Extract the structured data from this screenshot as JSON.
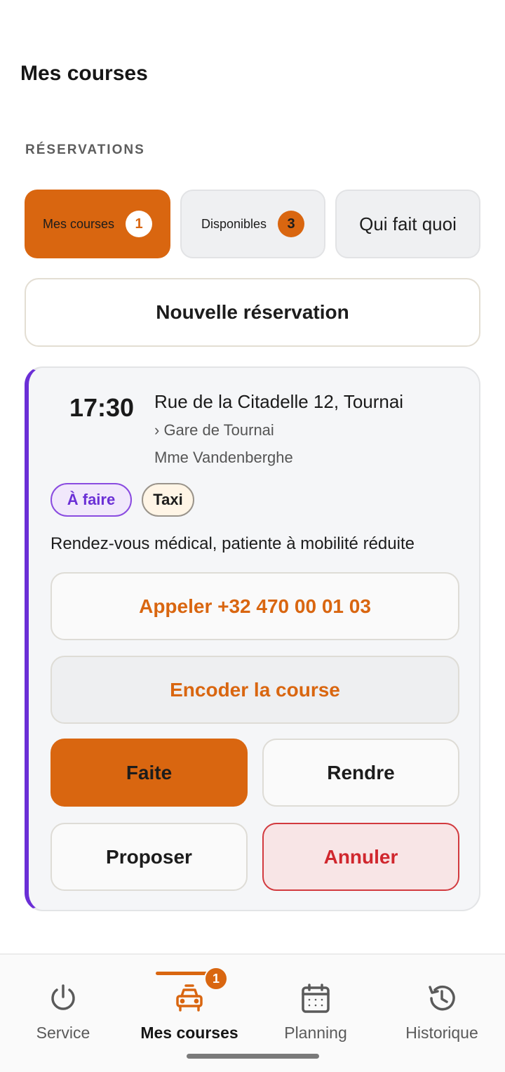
{
  "header": {
    "title": "Mes courses"
  },
  "section_label": "RÉSERVATIONS",
  "tabs": [
    {
      "label": "Mes courses",
      "count": "1",
      "active": true
    },
    {
      "label": "Disponibles",
      "count": "3",
      "active": false
    },
    {
      "label": "Qui fait quoi",
      "active": false
    }
  ],
  "new_reservation_label": "Nouvelle réservation",
  "ride": {
    "time": "17:30",
    "address": "Rue de la Citadelle 12, Tournai",
    "destination": "› Gare de Tournai",
    "client": "Mme Vandenberghe",
    "status": "À faire",
    "type": "Taxi",
    "note": "Rendez-vous médical, patiente à mobilité réduite",
    "actions": {
      "call": "Appeler +32 470 00 01 03",
      "encode": "Encoder la course",
      "done": "Faite",
      "give_back": "Rendre",
      "propose": "Proposer",
      "cancel": "Annuler"
    }
  },
  "bottom_nav": [
    {
      "label": "Service",
      "icon": "power-icon"
    },
    {
      "label": "Mes courses",
      "icon": "car-icon",
      "badge": "1",
      "active": true
    },
    {
      "label": "Planning",
      "icon": "calendar-icon"
    },
    {
      "label": "Historique",
      "icon": "history-icon"
    }
  ],
  "colors": {
    "accent": "#d96610",
    "status_purple": "#6b2fd6",
    "danger": "#d0272e"
  }
}
